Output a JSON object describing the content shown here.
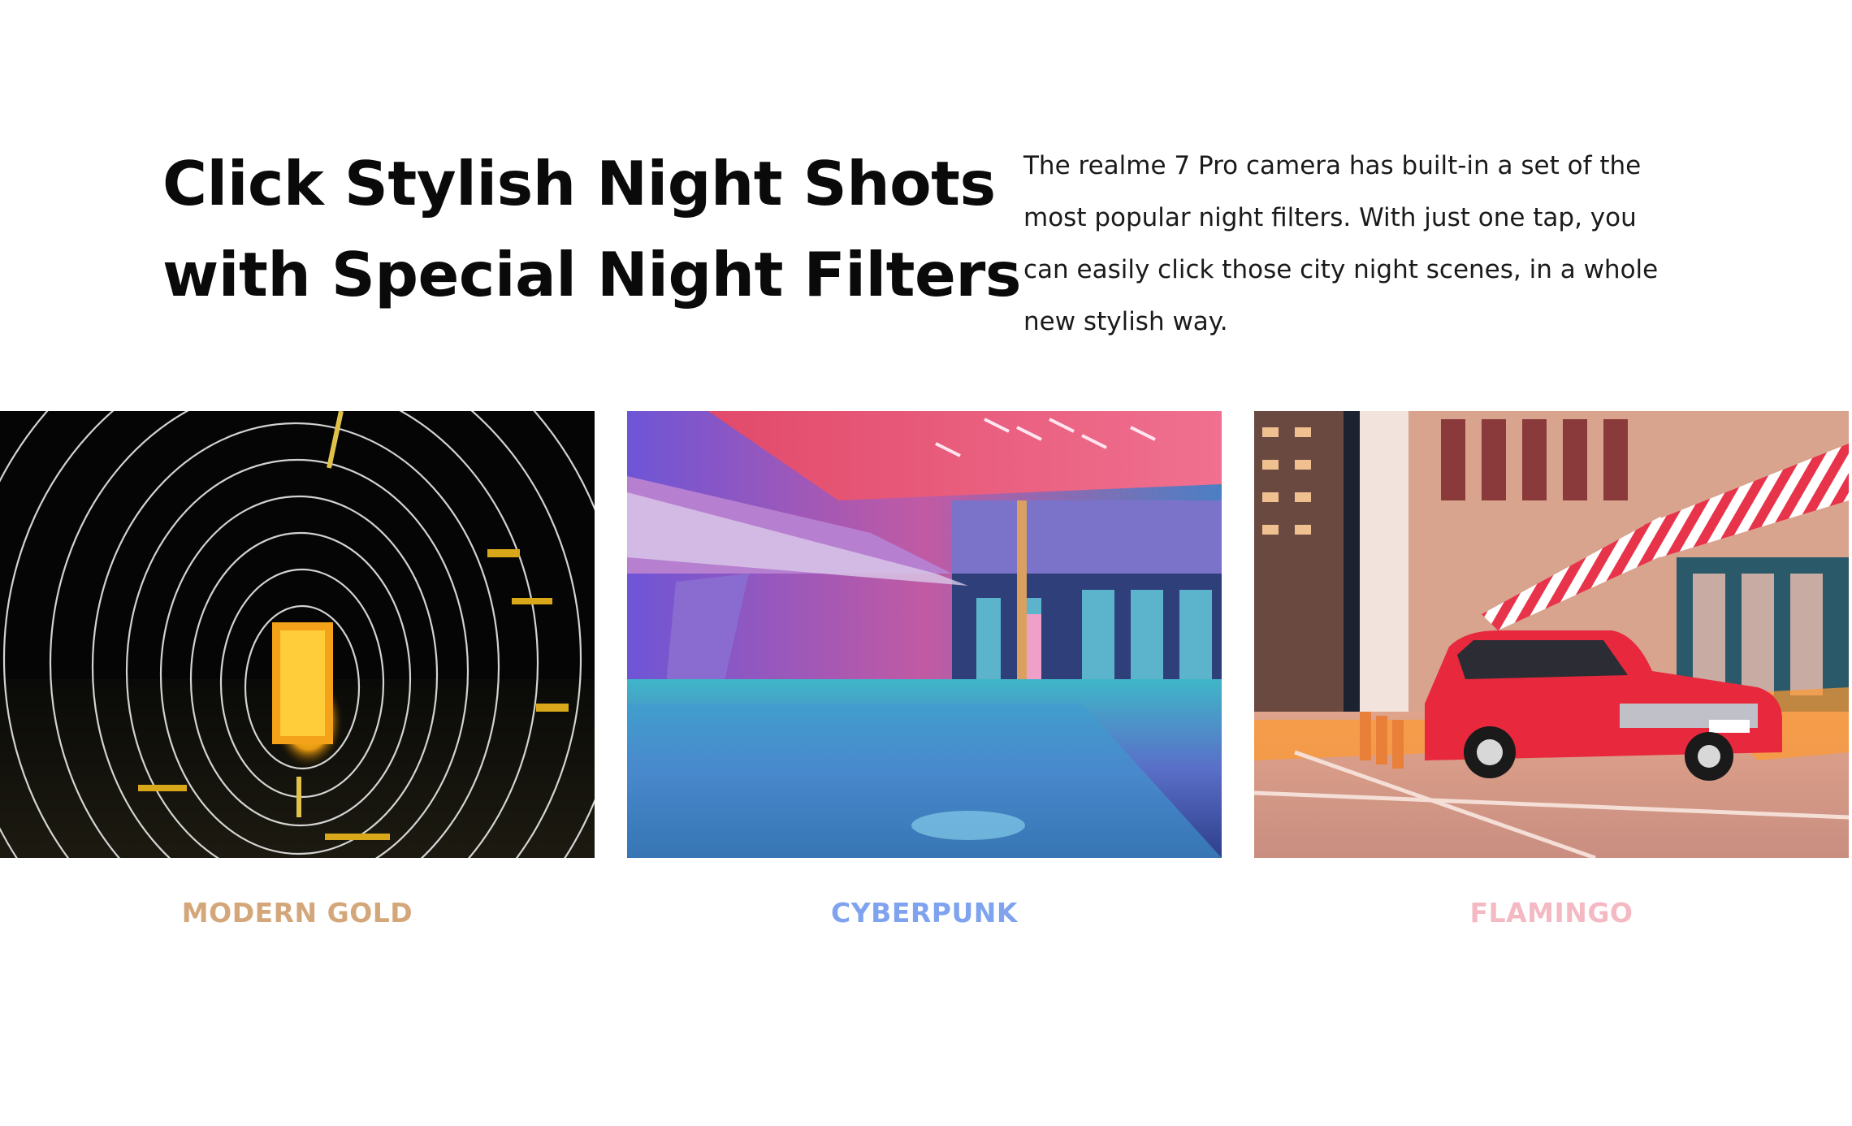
{
  "headline": {
    "line1": "Click Stylish Night Shots",
    "line2": "with Special Night Filters"
  },
  "description": "The realme 7 Pro camera has built-in a set of the most popular night filters. With just one tap, you can easily click those city night scenes, in a whole new stylish way.",
  "filters": [
    {
      "label": "MODERN GOLD",
      "color": "#d4a77b",
      "image": "light-tunnel-photo"
    },
    {
      "label": "CYBERPUNK",
      "color": "#7fa3ee",
      "image": "neon-plaza-photo"
    },
    {
      "label": "FLAMINGO",
      "color": "#f4b9c3",
      "image": "red-taxi-street-photo"
    }
  ]
}
